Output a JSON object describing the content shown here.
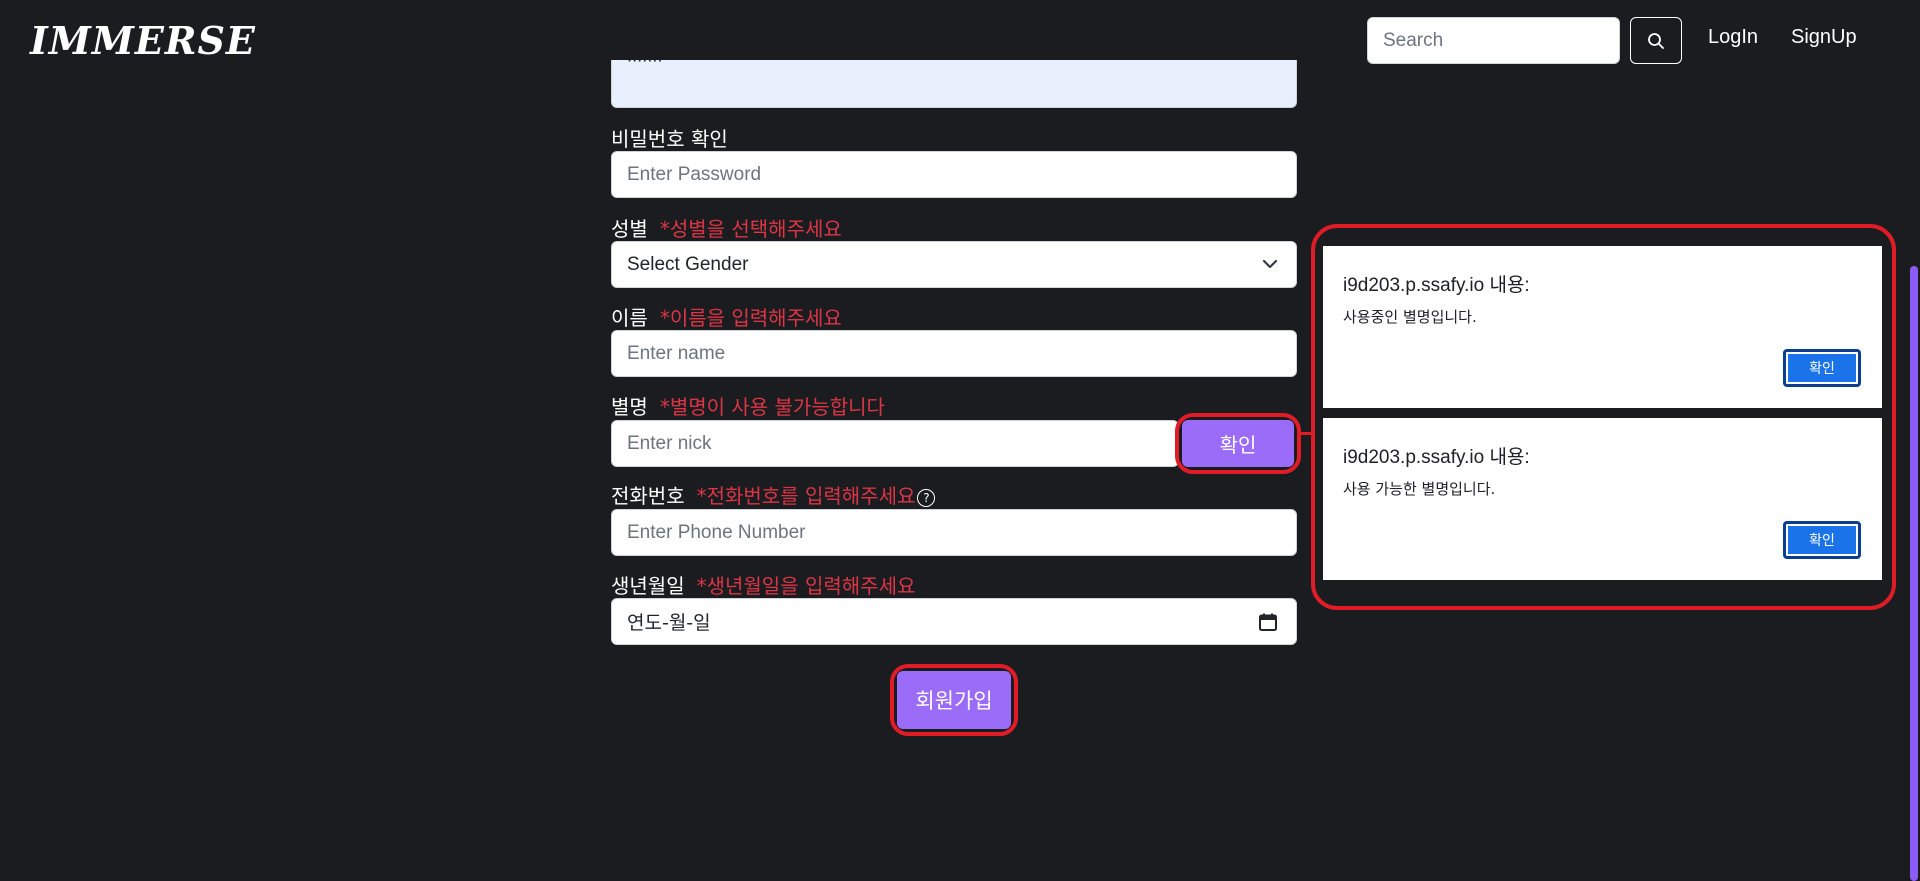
{
  "header": {
    "logo": "IMMERSE",
    "search_placeholder": "Search",
    "login": "LogIn",
    "signup": "SignUp"
  },
  "form": {
    "password_partial": "·······",
    "password_confirm": {
      "label": "비밀번호 확인",
      "placeholder": "Enter Password"
    },
    "gender": {
      "label": "성별",
      "warning": "*성별을 선택해주세요",
      "selected": "Select Gender"
    },
    "name": {
      "label": "이름",
      "warning": "*이름을 입력해주세요",
      "placeholder": "Enter name"
    },
    "nick": {
      "label": "별명",
      "warning": "*별명이 사용 불가능합니다",
      "placeholder": "Enter nick",
      "check_button": "확인"
    },
    "phone": {
      "label": "전화번호",
      "warning": "*전화번호를 입력해주세요",
      "help": "?",
      "placeholder": "Enter Phone Number"
    },
    "birth": {
      "label": "생년월일",
      "warning": "*생년월일을 입력해주세요",
      "value": "연도-월-일"
    },
    "submit": "회원가입"
  },
  "dialogs": [
    {
      "title": "i9d203.p.ssafy.io 내용:",
      "message": "사용중인 별명입니다.",
      "ok": "확인"
    },
    {
      "title": "i9d203.p.ssafy.io 내용:",
      "message": "사용 가능한 별명입니다.",
      "ok": "확인"
    }
  ],
  "colors": {
    "background": "#1b1c20",
    "accent_purple": "#9b6cf8",
    "highlight_red": "#e01c27",
    "dialog_button_blue": "#1a73e8",
    "warning_red": "#dc3545"
  }
}
